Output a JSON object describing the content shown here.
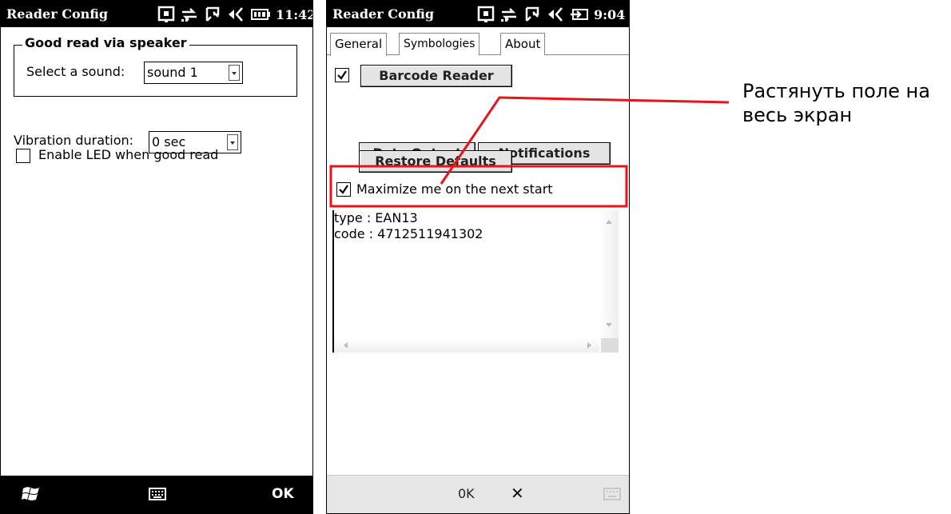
{
  "left_screen": {
    "title": "Reader Config",
    "time": "11:42",
    "groupbox_title": "Good read via speaker",
    "sound_label": "Select a sound:",
    "sound_value": "sound 1",
    "vibration_label": "Vibration duration:",
    "vibration_value": "0 sec",
    "led_label": "Enable LED when good read",
    "led_checked": false,
    "softkey_right": "OK",
    "icons": [
      "signal-icon",
      "connectivity-icon",
      "data-icon",
      "volume-icon",
      "battery-icon"
    ],
    "softbar_icons": [
      "windows-start-icon",
      "keyboard-icon"
    ]
  },
  "right_screen": {
    "title": "Reader Config",
    "time": "9:04",
    "tabs": [
      "General",
      "Symbologies",
      "About"
    ],
    "active_tab": "General",
    "barcode_reader_label": "Barcode Reader",
    "barcode_reader_checked": true,
    "buttons": {
      "data_output": "Data Output",
      "notifications": "Notifications",
      "restore_defaults": "Restore Defaults"
    },
    "maximize_label": "Maximize me on the next start",
    "maximize_checked": true,
    "output_lines": [
      "type : EAN13",
      "code : 4712511941302"
    ],
    "softkey_ok": "0K",
    "softkey_close": "✕",
    "icons": [
      "signal-icon",
      "connectivity-icon",
      "data-icon",
      "volume-icon",
      "charging-icon"
    ],
    "softbar_icons": [
      "keyboard-icon"
    ]
  },
  "annotation": {
    "text_line1": "Растянуть поле на",
    "text_line2": "весь экран",
    "color": "#e8141a"
  }
}
